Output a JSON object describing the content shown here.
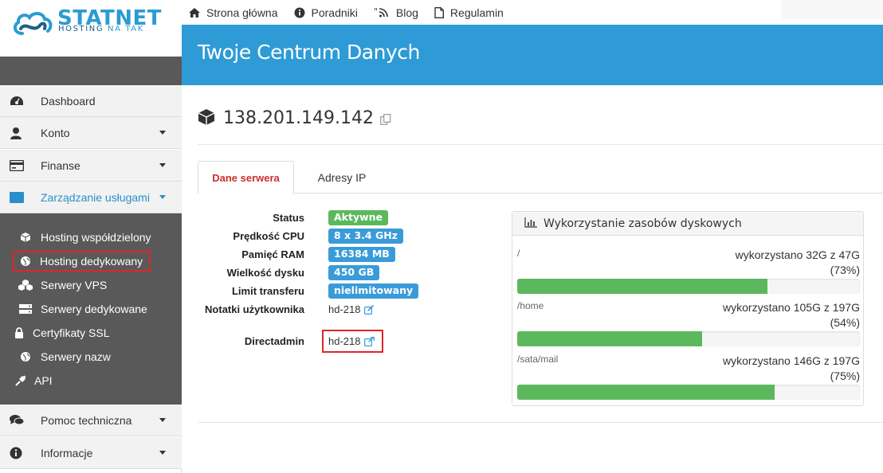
{
  "brand": {
    "name": "STATNET",
    "tagline_a": "HOSTING",
    "tagline_b": "NA TAK"
  },
  "topnav": [
    {
      "label": "Strona główna",
      "icon": "home-icon"
    },
    {
      "label": "Poradniki",
      "icon": "info-circle-icon"
    },
    {
      "label": "Blog",
      "icon": "rss-icon"
    },
    {
      "label": "Regulamin",
      "icon": "file-icon"
    }
  ],
  "page_title": "Twoje Centrum Danych",
  "sidebar": {
    "items": [
      {
        "label": "Dashboard",
        "icon": "dashboard-icon"
      },
      {
        "label": "Konto",
        "icon": "user-icon"
      },
      {
        "label": "Finanse",
        "icon": "credit-card-icon"
      },
      {
        "label": "Zarządzanie usługami",
        "icon": "list-icon"
      },
      {
        "label": "Pomoc techniczna",
        "icon": "comments-icon"
      },
      {
        "label": "Informacje",
        "icon": "info-circle-icon"
      }
    ],
    "submenu": [
      {
        "label": "Hosting współdzielony",
        "icon": "cube-icon"
      },
      {
        "label": "Hosting dedykowany",
        "icon": "globe-icon"
      },
      {
        "label": "Serwery VPS",
        "icon": "cubes-icon"
      },
      {
        "label": "Serwery dedykowane",
        "icon": "server-icon"
      },
      {
        "label": "Certyfikaty SSL",
        "icon": "lock-icon"
      },
      {
        "label": "Serwery nazw",
        "icon": "globe-icon"
      },
      {
        "label": "API",
        "icon": "plug-icon"
      }
    ]
  },
  "server": {
    "ip": "138.201.149.142",
    "tabs": [
      "Dane serwera",
      "Adresy IP"
    ],
    "details": {
      "status_label": "Status",
      "status_value": "Aktywne",
      "cpu_label": "Prędkość CPU",
      "cpu_value": "8 x 3.4 GHz",
      "ram_label": "Pamięć RAM",
      "ram_value": "16384 MB",
      "disk_label": "Wielkość dysku",
      "disk_value": "450 GB",
      "transfer_label": "Limit transferu",
      "transfer_value": "nielimitowany",
      "notes_label": "Notatki użytkownika",
      "notes_value": "hd-218",
      "da_label": "Directadmin",
      "da_value": "hd-218"
    }
  },
  "disk_panel": {
    "title": "Wykorzystanie zasobów dyskowych",
    "disks": [
      {
        "path": "/",
        "usage": "wykorzystano 32G z 47G",
        "percent_label": "(73%)",
        "percent": 73
      },
      {
        "path": "/home",
        "usage": "wykorzystano 105G z 197G",
        "percent_label": "(54%)",
        "percent": 54
      },
      {
        "path": "/sata/mail",
        "usage": "wykorzystano 146G z 197G",
        "percent_label": "(75%)",
        "percent": 75
      }
    ]
  },
  "colors": {
    "accent": "#2e9bd6",
    "success": "#5cb85c",
    "highlight": "#e0242a",
    "tab_active": "#c9302c"
  }
}
